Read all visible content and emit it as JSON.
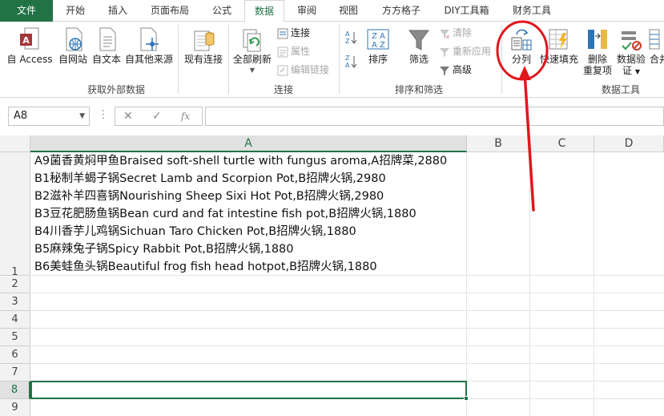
{
  "tabs": [
    {
      "label": "文件",
      "state": "file"
    },
    {
      "label": "开始"
    },
    {
      "label": "插入"
    },
    {
      "label": "页面布局"
    },
    {
      "label": "公式"
    },
    {
      "label": "数据",
      "state": "active"
    },
    {
      "label": "审阅"
    },
    {
      "label": "视图"
    },
    {
      "label": "方方格子"
    },
    {
      "label": "DIY工具箱"
    },
    {
      "label": "财务工具"
    }
  ],
  "ribbon": {
    "get_external": {
      "from_access": "自 Access",
      "from_web": "自网站",
      "from_text": "自文本",
      "from_other": "自其他来源",
      "existing_conn": "现有连接",
      "group": "获取外部数据"
    },
    "connections": {
      "refresh_all": "全部刷新",
      "connections": "连接",
      "properties": "属性",
      "edit_links": "编辑链接",
      "group": "连接"
    },
    "sort_filter": {
      "sort": "排序",
      "filter": "筛选",
      "clear": "清除",
      "reapply": "重新应用",
      "advanced": "高级",
      "group": "排序和筛选"
    },
    "data_tools": {
      "text_to_columns": "分列",
      "flash_fill": "快速填充",
      "remove_dup_1": "删除",
      "remove_dup_2": "重复项",
      "validation_1": "数据验",
      "validation_2": "证",
      "consolidate": "合并",
      "group": "数据工具"
    }
  },
  "formula_bar": {
    "name_box": "A8",
    "cancel": "✕",
    "enter": "✓",
    "fx": "fx",
    "formula": ""
  },
  "columns": [
    "A",
    "B",
    "C",
    "D"
  ],
  "rows": [
    "1",
    "2",
    "3",
    "4",
    "5",
    "6",
    "7",
    "8",
    "9"
  ],
  "cell_A1_lines": [
    "A9菌香黄焖甲鱼Braised soft-shell turtle with fungus aroma,A招牌菜,2880",
    "B1秘制羊蝎子锅Secret Lamb and Scorpion Pot,B招牌火锅,2980",
    "B2滋补羊四喜锅Nourishing Sheep Sixi Hot Pot,B招牌火锅,2980",
    "B3豆花肥肠鱼锅Bean curd and fat intestine fish pot,B招牌火锅,1880",
    "B4川香芋儿鸡锅Sichuan Taro Chicken Pot,B招牌火锅,1880",
    "B5麻辣兔子锅Spicy Rabbit Pot,B招牌火锅,1880",
    "B6美蛙鱼头锅Beautiful frog fish head hotpot,B招牌火锅,1880"
  ],
  "colors": {
    "excel_green": "#217346",
    "annotation_red": "#e0161d"
  }
}
